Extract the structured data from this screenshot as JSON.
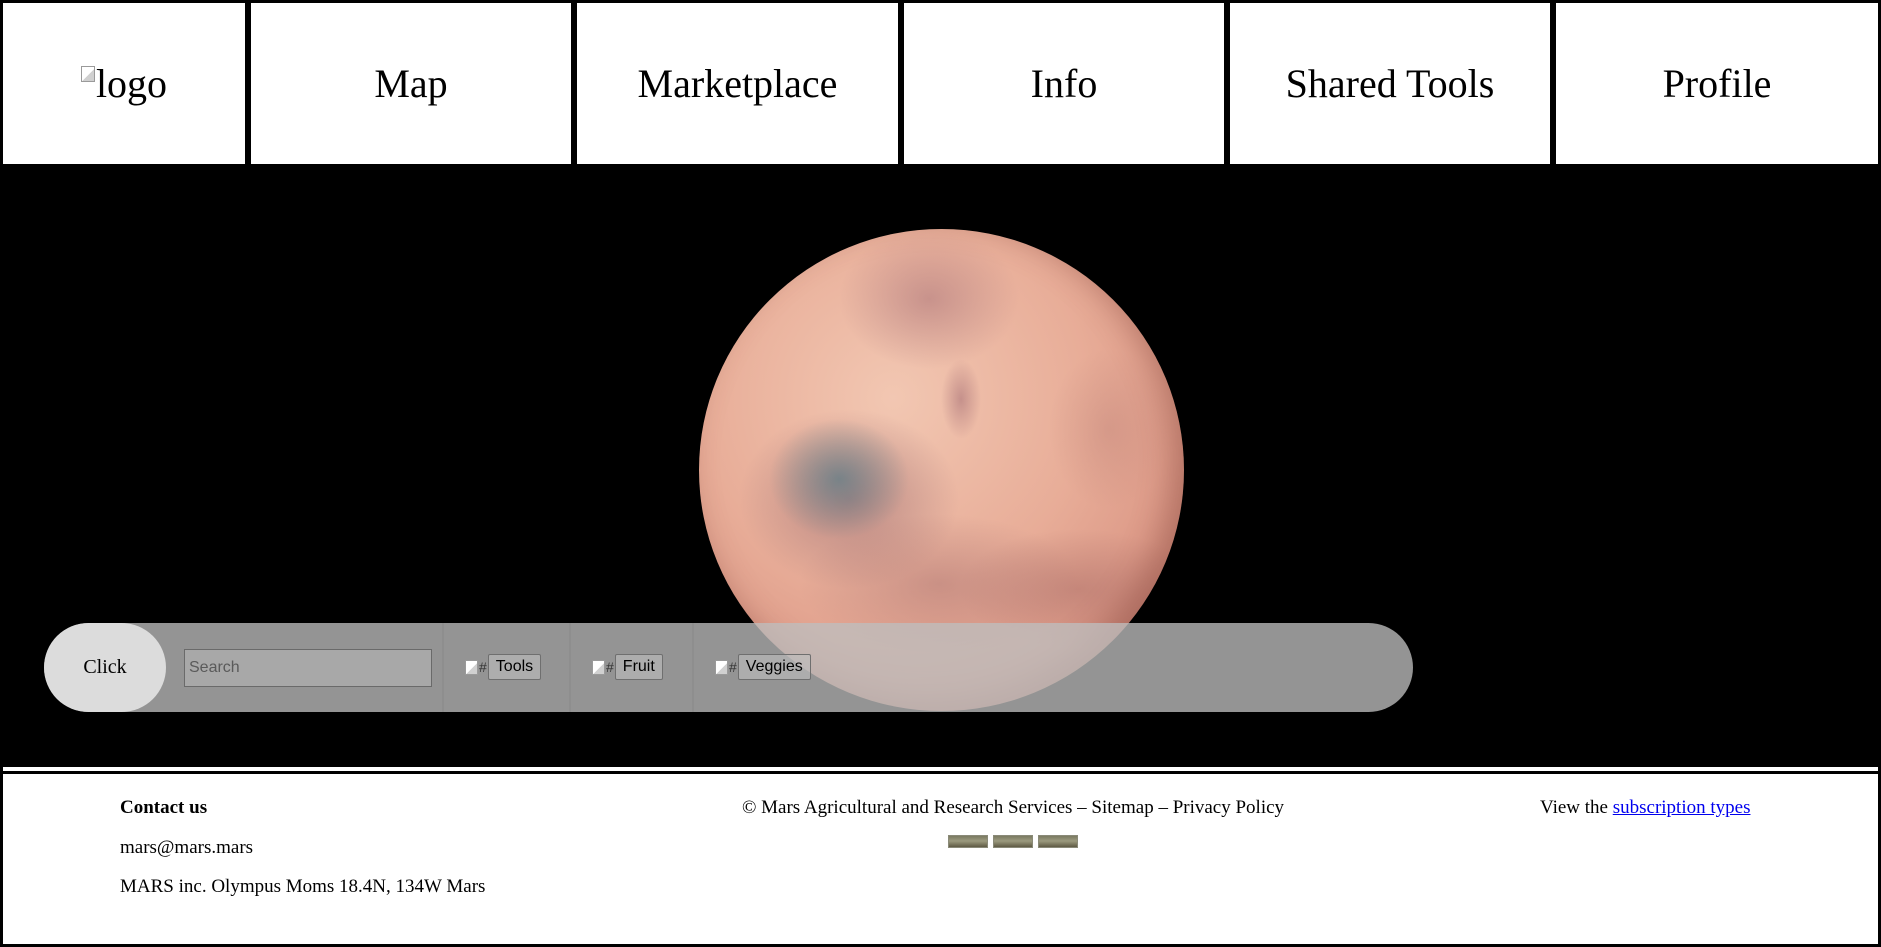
{
  "nav": {
    "logo_alt": "logo",
    "items": [
      {
        "label": "Map"
      },
      {
        "label": "Marketplace"
      },
      {
        "label": "Info"
      },
      {
        "label": "Shared Tools"
      },
      {
        "label": "Profile"
      }
    ]
  },
  "hero": {
    "planet_image": "mars-planet",
    "filter_bar": {
      "click_label": "Click",
      "search_placeholder": "Search",
      "search_value": "",
      "categories": [
        {
          "img_alt": "#",
          "label": "Tools"
        },
        {
          "img_alt": "#",
          "label": "Fruit"
        },
        {
          "img_alt": "#",
          "label": "Veggies"
        }
      ]
    }
  },
  "footer": {
    "contact_heading": "Contact us",
    "email": "mars@mars.mars",
    "address": "MARS inc. Olympus Moms 18.4N, 134W Mars",
    "copyright": "© Mars Agricultural and Research Services – Sitemap – Privacy Policy",
    "subscription_prefix": "View the ",
    "subscription_link": "subscription types"
  },
  "colors": {
    "hero_background": "#000000",
    "planet_base": "#e8ad98",
    "link": "#0000ee"
  }
}
